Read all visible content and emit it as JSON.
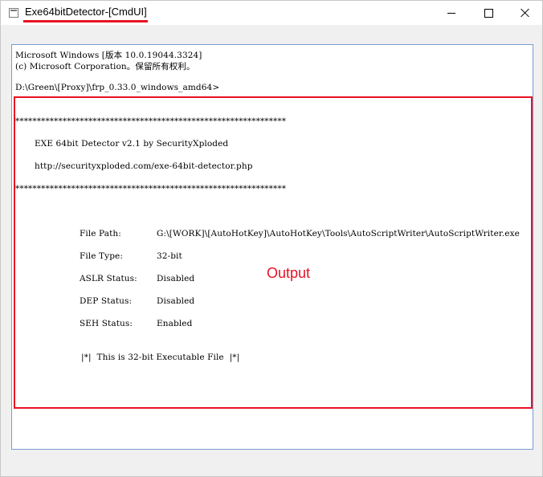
{
  "window": {
    "title": "Exe64bitDetector-[CmdUI]",
    "controls": {
      "minimize": "minimize",
      "maximize": "maximize",
      "close": "close"
    }
  },
  "console": {
    "header": [
      "Microsoft Windows [版本 10.0.19044.3324]",
      "(c) Microsoft Corporation。保留所有权利。"
    ],
    "prompt": "D:\\Green\\[Proxy]\\frp_0.33.0_windows_amd64>",
    "stars": "***************************************************************",
    "banner_title": "EXE 64bit Detector v2.1 by SecurityXploded",
    "banner_url": "http://securityxploded.com/exe-64bit-detector.php",
    "fields": [
      {
        "label": "File Path:",
        "value": "G:\\[WORK]\\[AutoHotKey]\\AutoHotKey\\Tools\\AutoScriptWriter\\AutoScriptWriter.exe"
      },
      {
        "label": "File Type:",
        "value": "32-bit"
      },
      {
        "label": "ASLR Status:",
        "value": "Disabled"
      },
      {
        "label": "DEP Status:",
        "value": "Disabled"
      },
      {
        "label": "SEH Status:",
        "value": "Enabled"
      }
    ],
    "result": "|*|  This is 32-bit Executable File  |*|"
  },
  "annotation": {
    "output_label": "Output",
    "color": "#e81123"
  }
}
